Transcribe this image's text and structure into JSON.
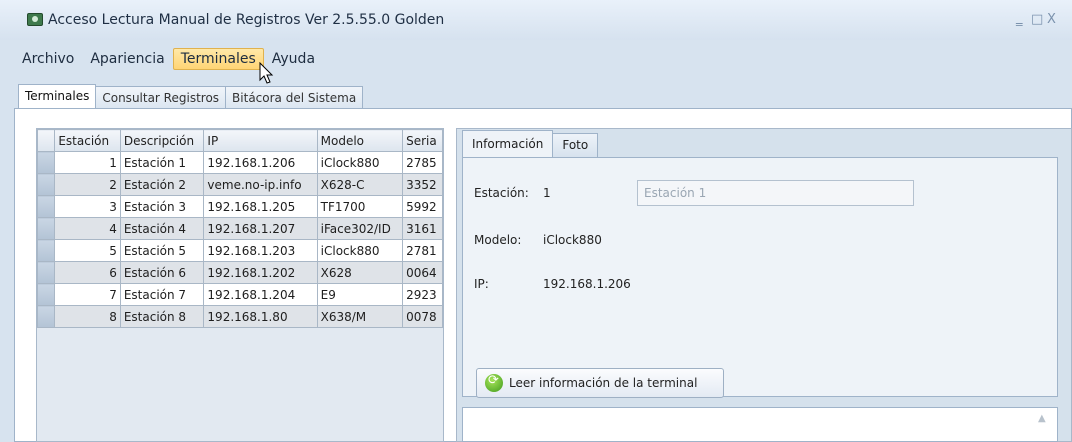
{
  "window": {
    "title": "Acceso Lectura Manual de Registros Ver 2.5.55.0 Golden",
    "controls": [
      "‗",
      "□",
      "X"
    ]
  },
  "menu": [
    "Archivo",
    "Apariencia",
    "Terminales",
    "Ayuda"
  ],
  "main_tabs": [
    "Terminales",
    "Consultar Registros",
    "Bitácora del Sistema"
  ],
  "grid": {
    "columns": [
      "Estación",
      "Descripción",
      "IP",
      "Modelo",
      "Seria"
    ],
    "rows": [
      [
        "1",
        "Estación 1",
        "192.168.1.206",
        "iClock880",
        "2785"
      ],
      [
        "2",
        "Estación 2",
        "veme.no-ip.info",
        "X628-C",
        "3352"
      ],
      [
        "3",
        "Estación 3",
        "192.168.1.205",
        "TF1700",
        "5992"
      ],
      [
        "4",
        "Estación 4",
        "192.168.1.207",
        "iFace302/ID",
        "3161"
      ],
      [
        "5",
        "Estación 5",
        "192.168.1.203",
        "iClock880",
        "2781"
      ],
      [
        "6",
        "Estación 6",
        "192.168.1.202",
        "X628",
        "0064"
      ],
      [
        "7",
        "Estación 7",
        "192.168.1.204",
        "E9",
        "2923"
      ],
      [
        "8",
        "Estación 8",
        "192.168.1.80",
        "X638/M",
        "0078"
      ]
    ]
  },
  "info": {
    "tabs": [
      "Información",
      "Foto"
    ],
    "estacion_label": "Estación:",
    "estacion_value": "1",
    "estacion_field": "Estación 1",
    "modelo_label": "Modelo:",
    "modelo_value": "iClock880",
    "ip_label": "IP:",
    "ip_value": "192.168.1.206",
    "read_button": "Leer información de la terminal"
  }
}
